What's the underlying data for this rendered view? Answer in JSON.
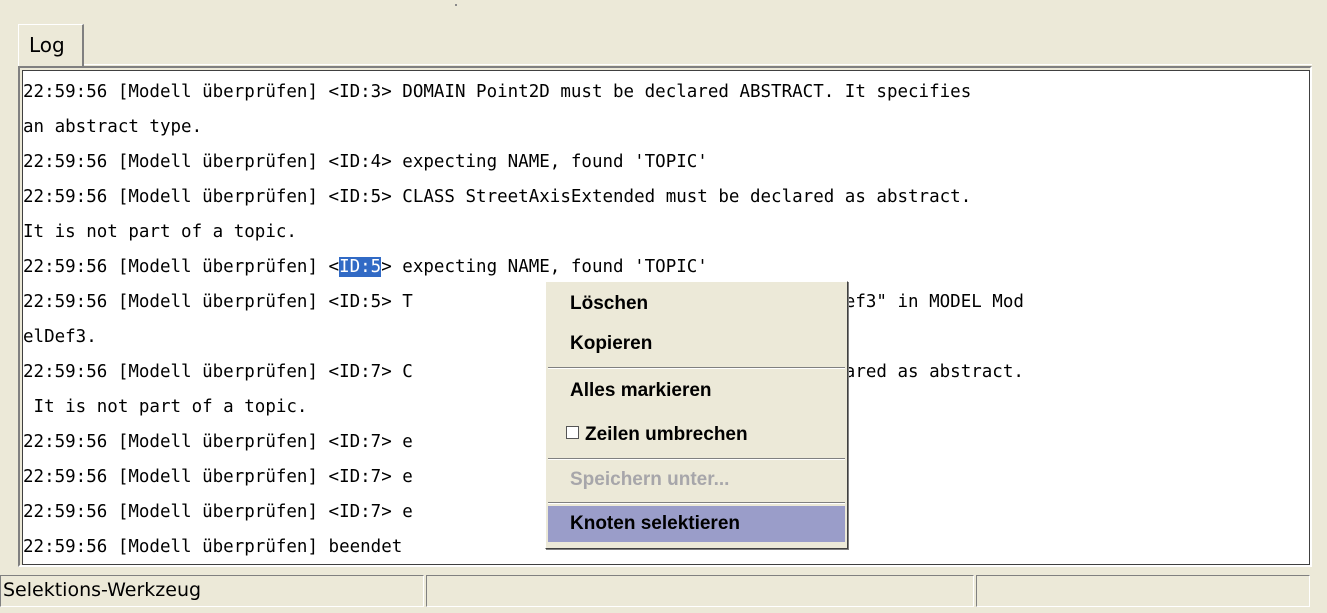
{
  "tab": {
    "label": "Log"
  },
  "log": {
    "lines": [
      "22:59:56 [Modell überprüfen] <ID:3> DOMAIN Point2D must be declared ABSTRACT. It specifies",
      "an abstract type.",
      "22:59:56 [Modell überprüfen] <ID:4> expecting NAME, found 'TOPIC'",
      "22:59:56 [Modell überprüfen] <ID:5> CLASS StreetAxisExtended must be declared as abstract.",
      "It is not part of a topic.",
      {
        "pre": "22:59:56 [Modell überprüfen] <",
        "sel": "ID:5",
        "post": "> expecting NAME, found 'TOPIC'"
      },
      "22:59:56 [Modell überprüfen] <ID:5> T                         tructure \"ModelDef3\" in MODEL Mod",
      "elDef3.",
      "22:59:56 [Modell überprüfen] <ID:7> C                         led must be declared as abstract.",
      " It is not part of a topic.",
      "22:59:56 [Modell überprüfen] <ID:7> e                         TOPIC'",
      "22:59:56 [Modell überprüfen] <ID:7> e                         TOPIC'",
      "22:59:56 [Modell überprüfen] <ID:7> e                         '",
      "22:59:56 [Modell überprüfen] beendet"
    ]
  },
  "context_menu": {
    "delete": "Löschen",
    "copy": "Kopieren",
    "select_all": "Alles markieren",
    "wrap_lines": "Zeilen  umbrechen",
    "save_as": "Speichern unter...",
    "select_nodes": "Knoten selektieren",
    "wrap_checked": false
  },
  "status": {
    "text": "Selektions-Werkzeug",
    "pane2": "",
    "pane3": ""
  }
}
